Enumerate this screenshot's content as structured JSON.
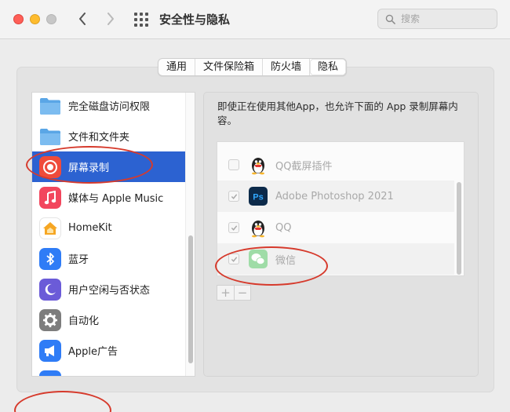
{
  "window": {
    "title": "安全性与隐私",
    "search_placeholder": "搜索"
  },
  "tabs": [
    {
      "label": "通用",
      "active": false
    },
    {
      "label": "文件保险箱",
      "active": false
    },
    {
      "label": "防火墙",
      "active": false
    },
    {
      "label": "隐私",
      "active": true
    }
  ],
  "sidebar": {
    "items": [
      {
        "label": "完全磁盘访问权限",
        "icon": "folder-icon",
        "selected": false
      },
      {
        "label": "文件和文件夹",
        "icon": "folder-icon",
        "selected": false
      },
      {
        "label": "屏幕录制",
        "icon": "screen-recording-icon",
        "selected": true
      },
      {
        "label": "媒体与 Apple Music",
        "icon": "music-note-icon",
        "selected": false
      },
      {
        "label": "HomeKit",
        "icon": "homekit-house-icon",
        "selected": false
      },
      {
        "label": "蓝牙",
        "icon": "bluetooth-icon",
        "selected": false
      },
      {
        "label": "用户空闲与否状态",
        "icon": "moon-icon",
        "selected": false
      },
      {
        "label": "自动化",
        "icon": "gear-icon",
        "selected": false
      },
      {
        "label": "Apple广告",
        "icon": "megaphone-icon",
        "selected": false
      }
    ]
  },
  "main": {
    "description": "即使正在使用其他App，也允许下面的 App 录制屏幕内容。",
    "apps": [
      {
        "name": "QQ截屏插件",
        "checked": false,
        "icon": "qq-penguin-icon"
      },
      {
        "name": "Adobe Photoshop 2021",
        "checked": true,
        "icon": "photoshop-icon"
      },
      {
        "name": "QQ",
        "checked": true,
        "icon": "qq-penguin-icon"
      },
      {
        "name": "微信",
        "checked": true,
        "icon": "wechat-icon"
      }
    ],
    "add_label": "+",
    "remove_label": "−"
  },
  "colors": {
    "selection": "#2c62d1",
    "annotation": "#d63a2c"
  }
}
